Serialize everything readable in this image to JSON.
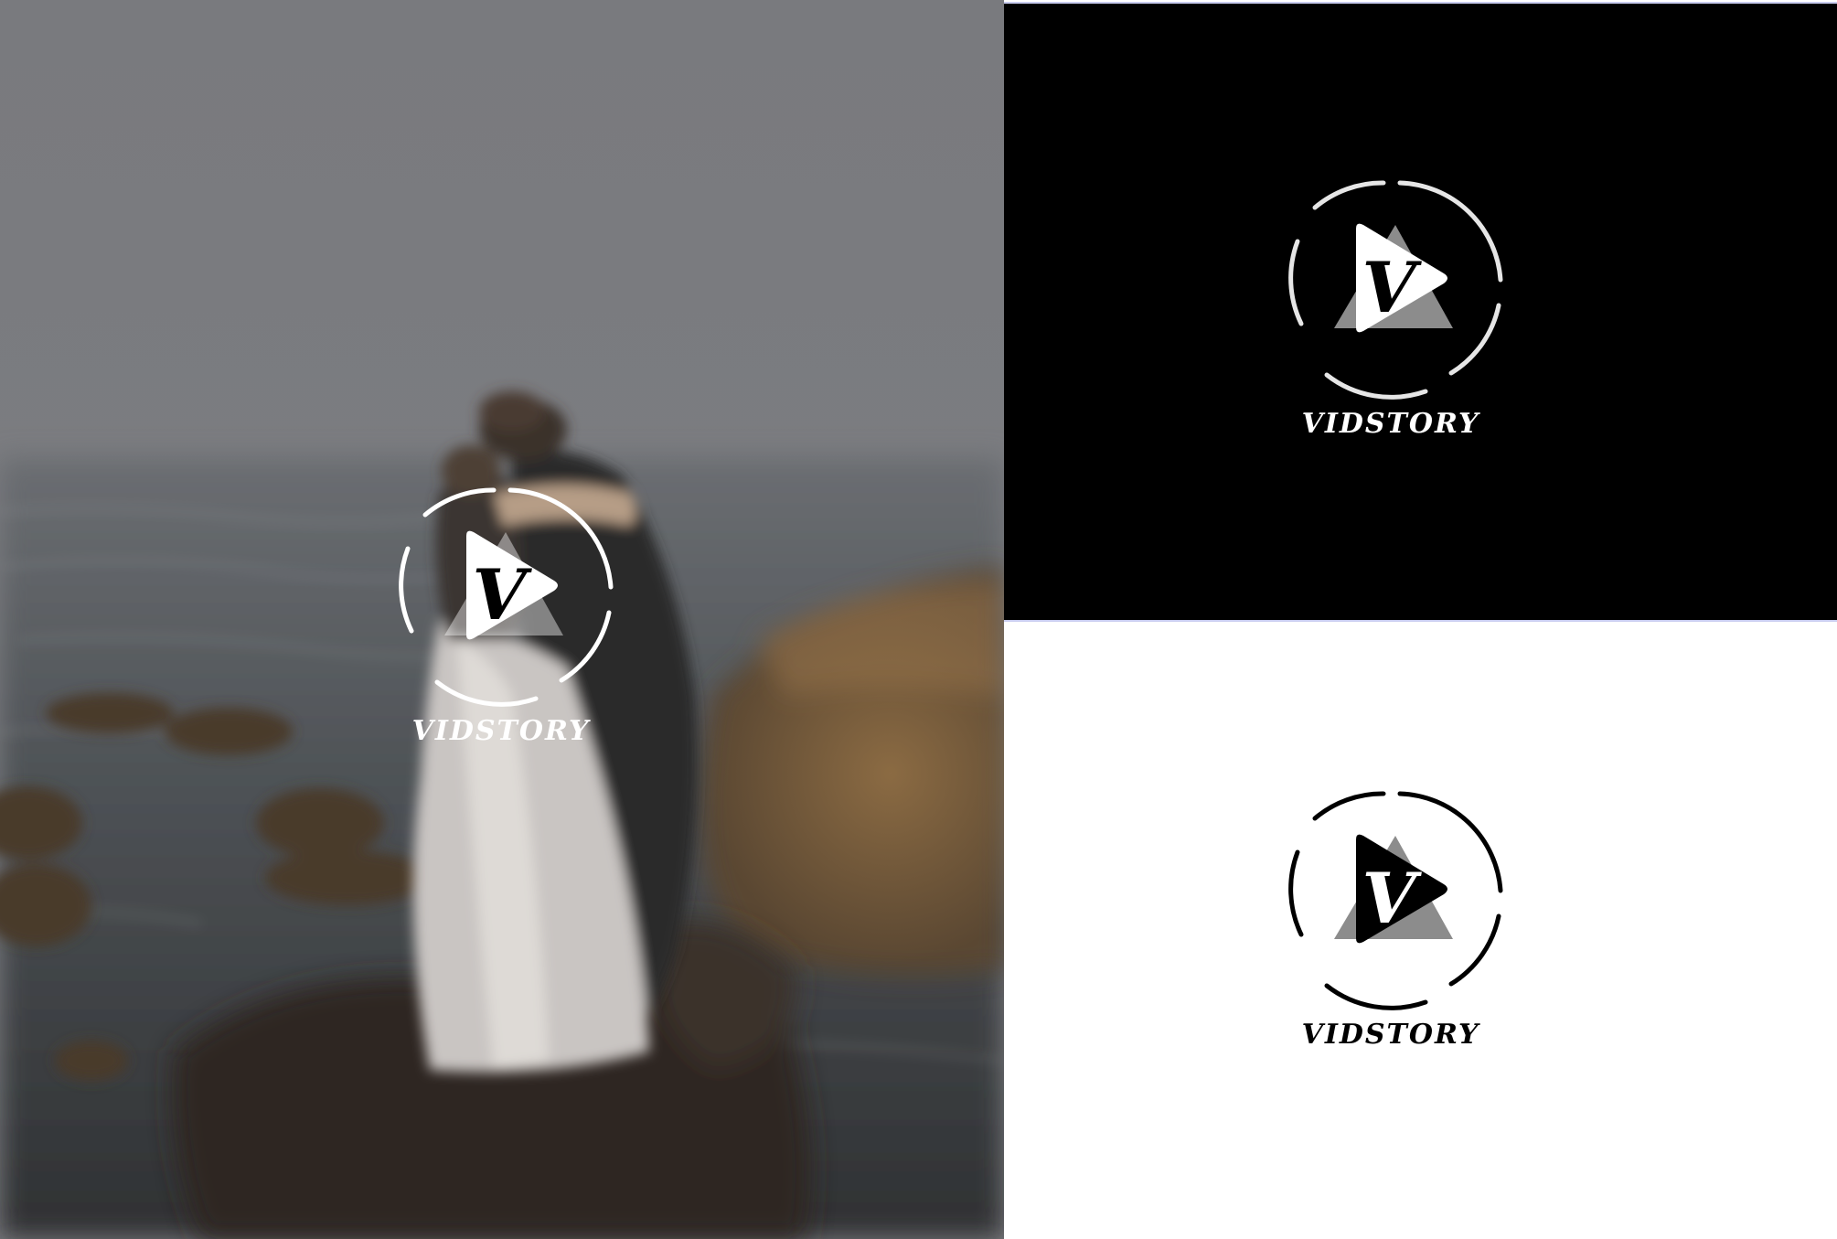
{
  "brand": {
    "name": "VIDSTORY",
    "monogram": "V"
  },
  "panels": [
    {
      "id": "photo",
      "background": "blurred-couple-seaside-photo",
      "logo_color": "#ffffff"
    },
    {
      "id": "dark",
      "background": "#000000",
      "logo_color": "#ffffff"
    },
    {
      "id": "light",
      "background": "#ffffff",
      "logo_color": "#000000"
    }
  ],
  "colors": {
    "triangle_back": "#8c8c8c",
    "photo_fog": "#7b7c80",
    "panel_border": "#c9cdf0"
  }
}
